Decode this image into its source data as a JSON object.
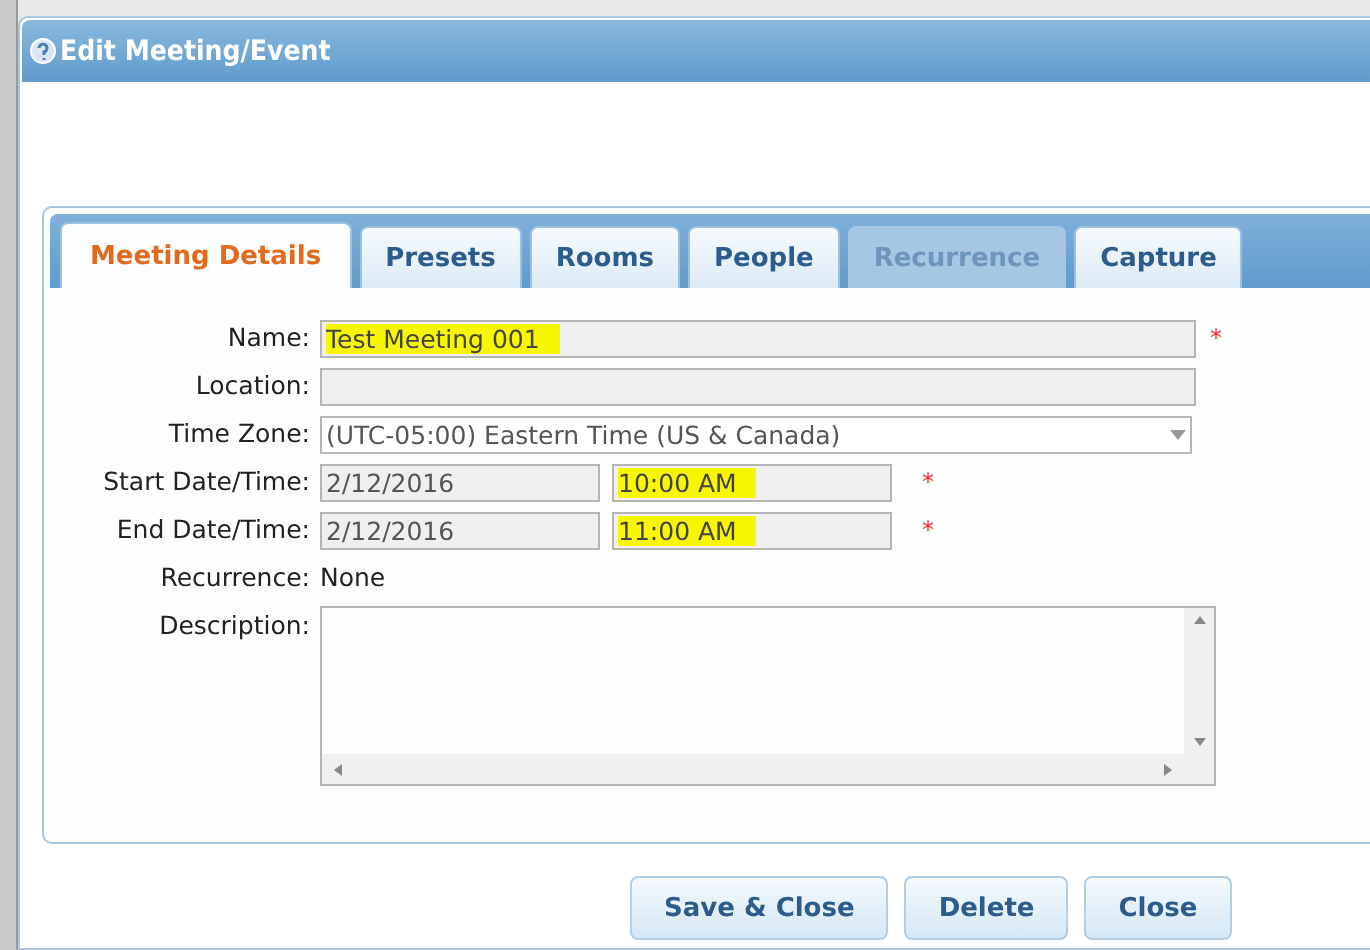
{
  "window": {
    "title": "Edit Meeting/Event"
  },
  "tabs": [
    {
      "label": "Meeting Details",
      "selected": true,
      "disabled": false
    },
    {
      "label": "Presets",
      "selected": false,
      "disabled": false
    },
    {
      "label": "Rooms",
      "selected": false,
      "disabled": false
    },
    {
      "label": "People",
      "selected": false,
      "disabled": false
    },
    {
      "label": "Recurrence",
      "selected": false,
      "disabled": true
    },
    {
      "label": "Capture",
      "selected": false,
      "disabled": false
    }
  ],
  "fields": [
    {
      "kind": "text",
      "label": "Name:",
      "value": "Test Meeting 001",
      "highlighted": true,
      "required": true
    },
    {
      "kind": "text",
      "label": "Location:",
      "required": false
    },
    {
      "kind": "select",
      "label": "Time Zone:",
      "value": "(UTC-05:00) Eastern Time (US & Canada)"
    },
    {
      "kind": "datetime",
      "label": "Start Date/Time:",
      "date": "2/12/2016",
      "time": "10:00 AM",
      "highlighted": true,
      "required": true
    },
    {
      "kind": "datetime",
      "label": "End Date/Time:",
      "date": "2/12/2016",
      "time": "11:00 AM",
      "highlighted": true,
      "required": true
    },
    {
      "kind": "static",
      "label": "Recurrence:",
      "value": "None"
    },
    {
      "kind": "textarea",
      "label": "Description:"
    }
  ],
  "required_mark": "*",
  "buttons": [
    "Save & Close",
    "Delete",
    "Close"
  ]
}
